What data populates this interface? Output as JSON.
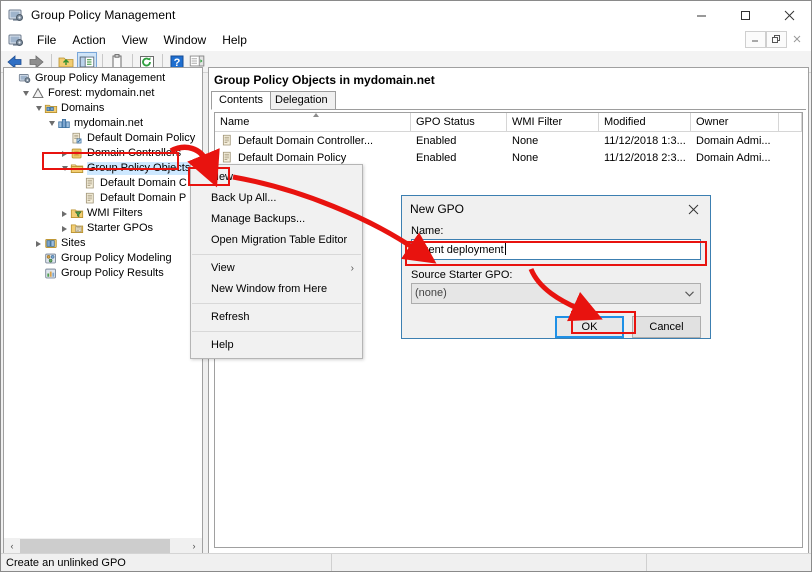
{
  "window": {
    "title": "Group Policy Management",
    "icon": "gpmc-icon",
    "controls": [
      {
        "name": "minimize-button",
        "glyph": "minimize-icon"
      },
      {
        "name": "maximize-button",
        "glyph": "maximize-icon"
      },
      {
        "name": "close-button",
        "glyph": "close-icon"
      }
    ],
    "mdi_controls": [
      {
        "name": "mdi-minimize-button",
        "glyph": "minimize-icon"
      },
      {
        "name": "mdi-restore-button",
        "glyph": "restore-icon"
      },
      {
        "name": "mdi-close-button",
        "glyph": "close-icon"
      }
    ]
  },
  "menubar": {
    "items": [
      "File",
      "Action",
      "View",
      "Window",
      "Help"
    ]
  },
  "toolbar": {
    "buttons": [
      "back-icon",
      "forward-icon",
      "up-folder-icon",
      "show-hide-console-tree-icon",
      "properties-icon",
      "refresh-icon",
      "help-icon",
      "show-hide-action-pane-icon"
    ]
  },
  "tree": {
    "items": [
      {
        "label": "Group Policy Management",
        "indent": 0,
        "twisty": "none",
        "icon": "gpmc-icon"
      },
      {
        "label": "Forest: mydomain.net",
        "indent": 1,
        "twisty": "expanded",
        "icon": "forest-icon"
      },
      {
        "label": "Domains",
        "indent": 2,
        "twisty": "expanded",
        "icon": "domains-icon"
      },
      {
        "label": "mydomain.net",
        "indent": 3,
        "twisty": "expanded",
        "icon": "domain-icon"
      },
      {
        "label": "Default Domain Policy",
        "indent": 4,
        "twisty": "none",
        "icon": "gpo-link-icon"
      },
      {
        "label": "Domain Controllers",
        "indent": 4,
        "twisty": "collapsed",
        "icon": "ou-icon"
      },
      {
        "label": "Group Policy Objects",
        "indent": 4,
        "twisty": "expanded",
        "icon": "folder-icon",
        "selected": true
      },
      {
        "label": "Default Domain C",
        "indent": 5,
        "twisty": "none",
        "icon": "gpo-icon"
      },
      {
        "label": "Default Domain P",
        "indent": 5,
        "twisty": "none",
        "icon": "gpo-icon"
      },
      {
        "label": "WMI Filters",
        "indent": 4,
        "twisty": "collapsed",
        "icon": "wmi-filter-icon"
      },
      {
        "label": "Starter GPOs",
        "indent": 4,
        "twisty": "collapsed",
        "icon": "starter-gpo-icon"
      },
      {
        "label": "Sites",
        "indent": 2,
        "twisty": "collapsed",
        "icon": "sites-icon"
      },
      {
        "label": "Group Policy Modeling",
        "indent": 2,
        "twisty": "none",
        "icon": "modeling-icon"
      },
      {
        "label": "Group Policy Results",
        "indent": 2,
        "twisty": "none",
        "icon": "results-icon"
      }
    ]
  },
  "rightpane": {
    "title": "Group Policy Objects in mydomain.net",
    "tabs": [
      {
        "label": "Contents",
        "active": true
      },
      {
        "label": "Delegation",
        "active": false
      }
    ],
    "columns": [
      "Name",
      "GPO Status",
      "WMI Filter",
      "Modified",
      "Owner"
    ],
    "rows": [
      {
        "name": "Default Domain Controller...",
        "status": "Enabled",
        "wmi": "None",
        "modified": "11/12/2018 1:3...",
        "owner": "Domain Admi...",
        "icon": "gpo-icon"
      },
      {
        "name": "Default Domain Policy",
        "status": "Enabled",
        "wmi": "None",
        "modified": "11/12/2018 2:3...",
        "owner": "Domain Admi...",
        "icon": "gpo-icon"
      }
    ]
  },
  "context_menu": {
    "items": [
      {
        "label": "New",
        "highlighted": true
      },
      {
        "label": "Back Up All..."
      },
      {
        "label": "Manage Backups..."
      },
      {
        "label": "Open Migration Table Editor"
      },
      {
        "separator": true
      },
      {
        "label": "View",
        "submenu": true
      },
      {
        "label": "New Window from Here"
      },
      {
        "separator": true
      },
      {
        "label": "Refresh"
      },
      {
        "separator": true
      },
      {
        "label": "Help"
      }
    ]
  },
  "dialog": {
    "title": "New GPO",
    "close_glyph": "close-icon",
    "name_label": "Name:",
    "name_value": "Agent deployment",
    "source_label": "Source Starter GPO:",
    "source_value": "(none)",
    "source_options": [
      "(none)"
    ],
    "ok_label": "OK",
    "cancel_label": "Cancel"
  },
  "statusbar": {
    "text": "Create an unlinked GPO"
  },
  "scrollbar": {
    "left_arrow": "‹",
    "right_arrow": "›"
  },
  "annotations": {
    "highlight_color": "#e8130f",
    "focus_color": "#1e90e6"
  }
}
